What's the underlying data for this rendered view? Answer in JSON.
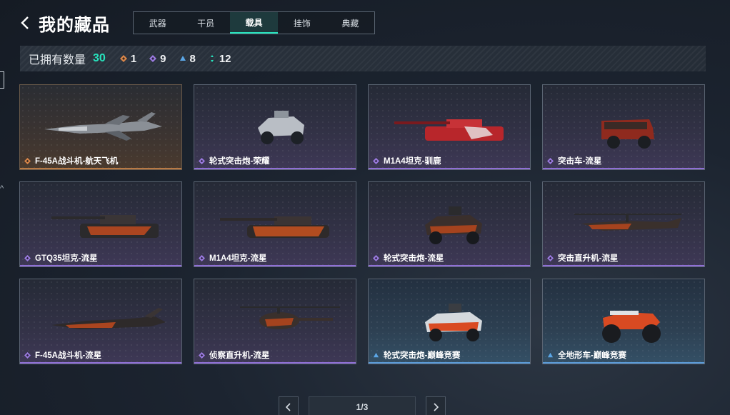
{
  "header": {
    "title": "我的藏品"
  },
  "tabs": [
    {
      "label": "武器",
      "active": false
    },
    {
      "label": "干员",
      "active": false
    },
    {
      "label": "载具",
      "active": true
    },
    {
      "label": "挂饰",
      "active": false
    },
    {
      "label": "典藏",
      "active": false
    }
  ],
  "stats": {
    "owned_label": "已拥有数量",
    "owned_count": "30",
    "orange_count": "1",
    "purple_count": "9",
    "blue_count": "8",
    "green_count": "12"
  },
  "colors": {
    "accent": "#27e3bd",
    "rarity_orange": "#d9864a",
    "rarity_purple": "#9b7be0",
    "rarity_blue": "#5ba6e6",
    "rarity_green": "#27e3bd"
  },
  "items": [
    {
      "name": "F-45A战斗机-航天飞机",
      "rarity": "orange",
      "vehicle": "jet-icon"
    },
    {
      "name": "轮式突击炮-荣耀",
      "rarity": "purple",
      "vehicle": "buggy-icon"
    },
    {
      "name": "M1A4坦克-驯鹿",
      "rarity": "purple",
      "vehicle": "tank-icon"
    },
    {
      "name": "突击车-流星",
      "rarity": "purple",
      "vehicle": "truck-icon"
    },
    {
      "name": "GTQ35坦克-流星",
      "rarity": "purple",
      "vehicle": "tank-icon"
    },
    {
      "name": "M1A4坦克-流星",
      "rarity": "purple",
      "vehicle": "tank-icon"
    },
    {
      "name": "轮式突击炮-流星",
      "rarity": "purple",
      "vehicle": "buggy-icon"
    },
    {
      "name": "突击直升机-流星",
      "rarity": "purple",
      "vehicle": "helicopter-icon"
    },
    {
      "name": "F-45A战斗机-流星",
      "rarity": "purple",
      "vehicle": "jet-icon"
    },
    {
      "name": "侦察直升机-流星",
      "rarity": "purple",
      "vehicle": "helicopter-icon"
    },
    {
      "name": "轮式突击炮-巅峰竞赛",
      "rarity": "blue",
      "vehicle": "buggy-icon"
    },
    {
      "name": "全地形车-巅峰竞赛",
      "rarity": "blue",
      "vehicle": "atv-icon"
    }
  ],
  "pager": {
    "label": "1/3"
  }
}
